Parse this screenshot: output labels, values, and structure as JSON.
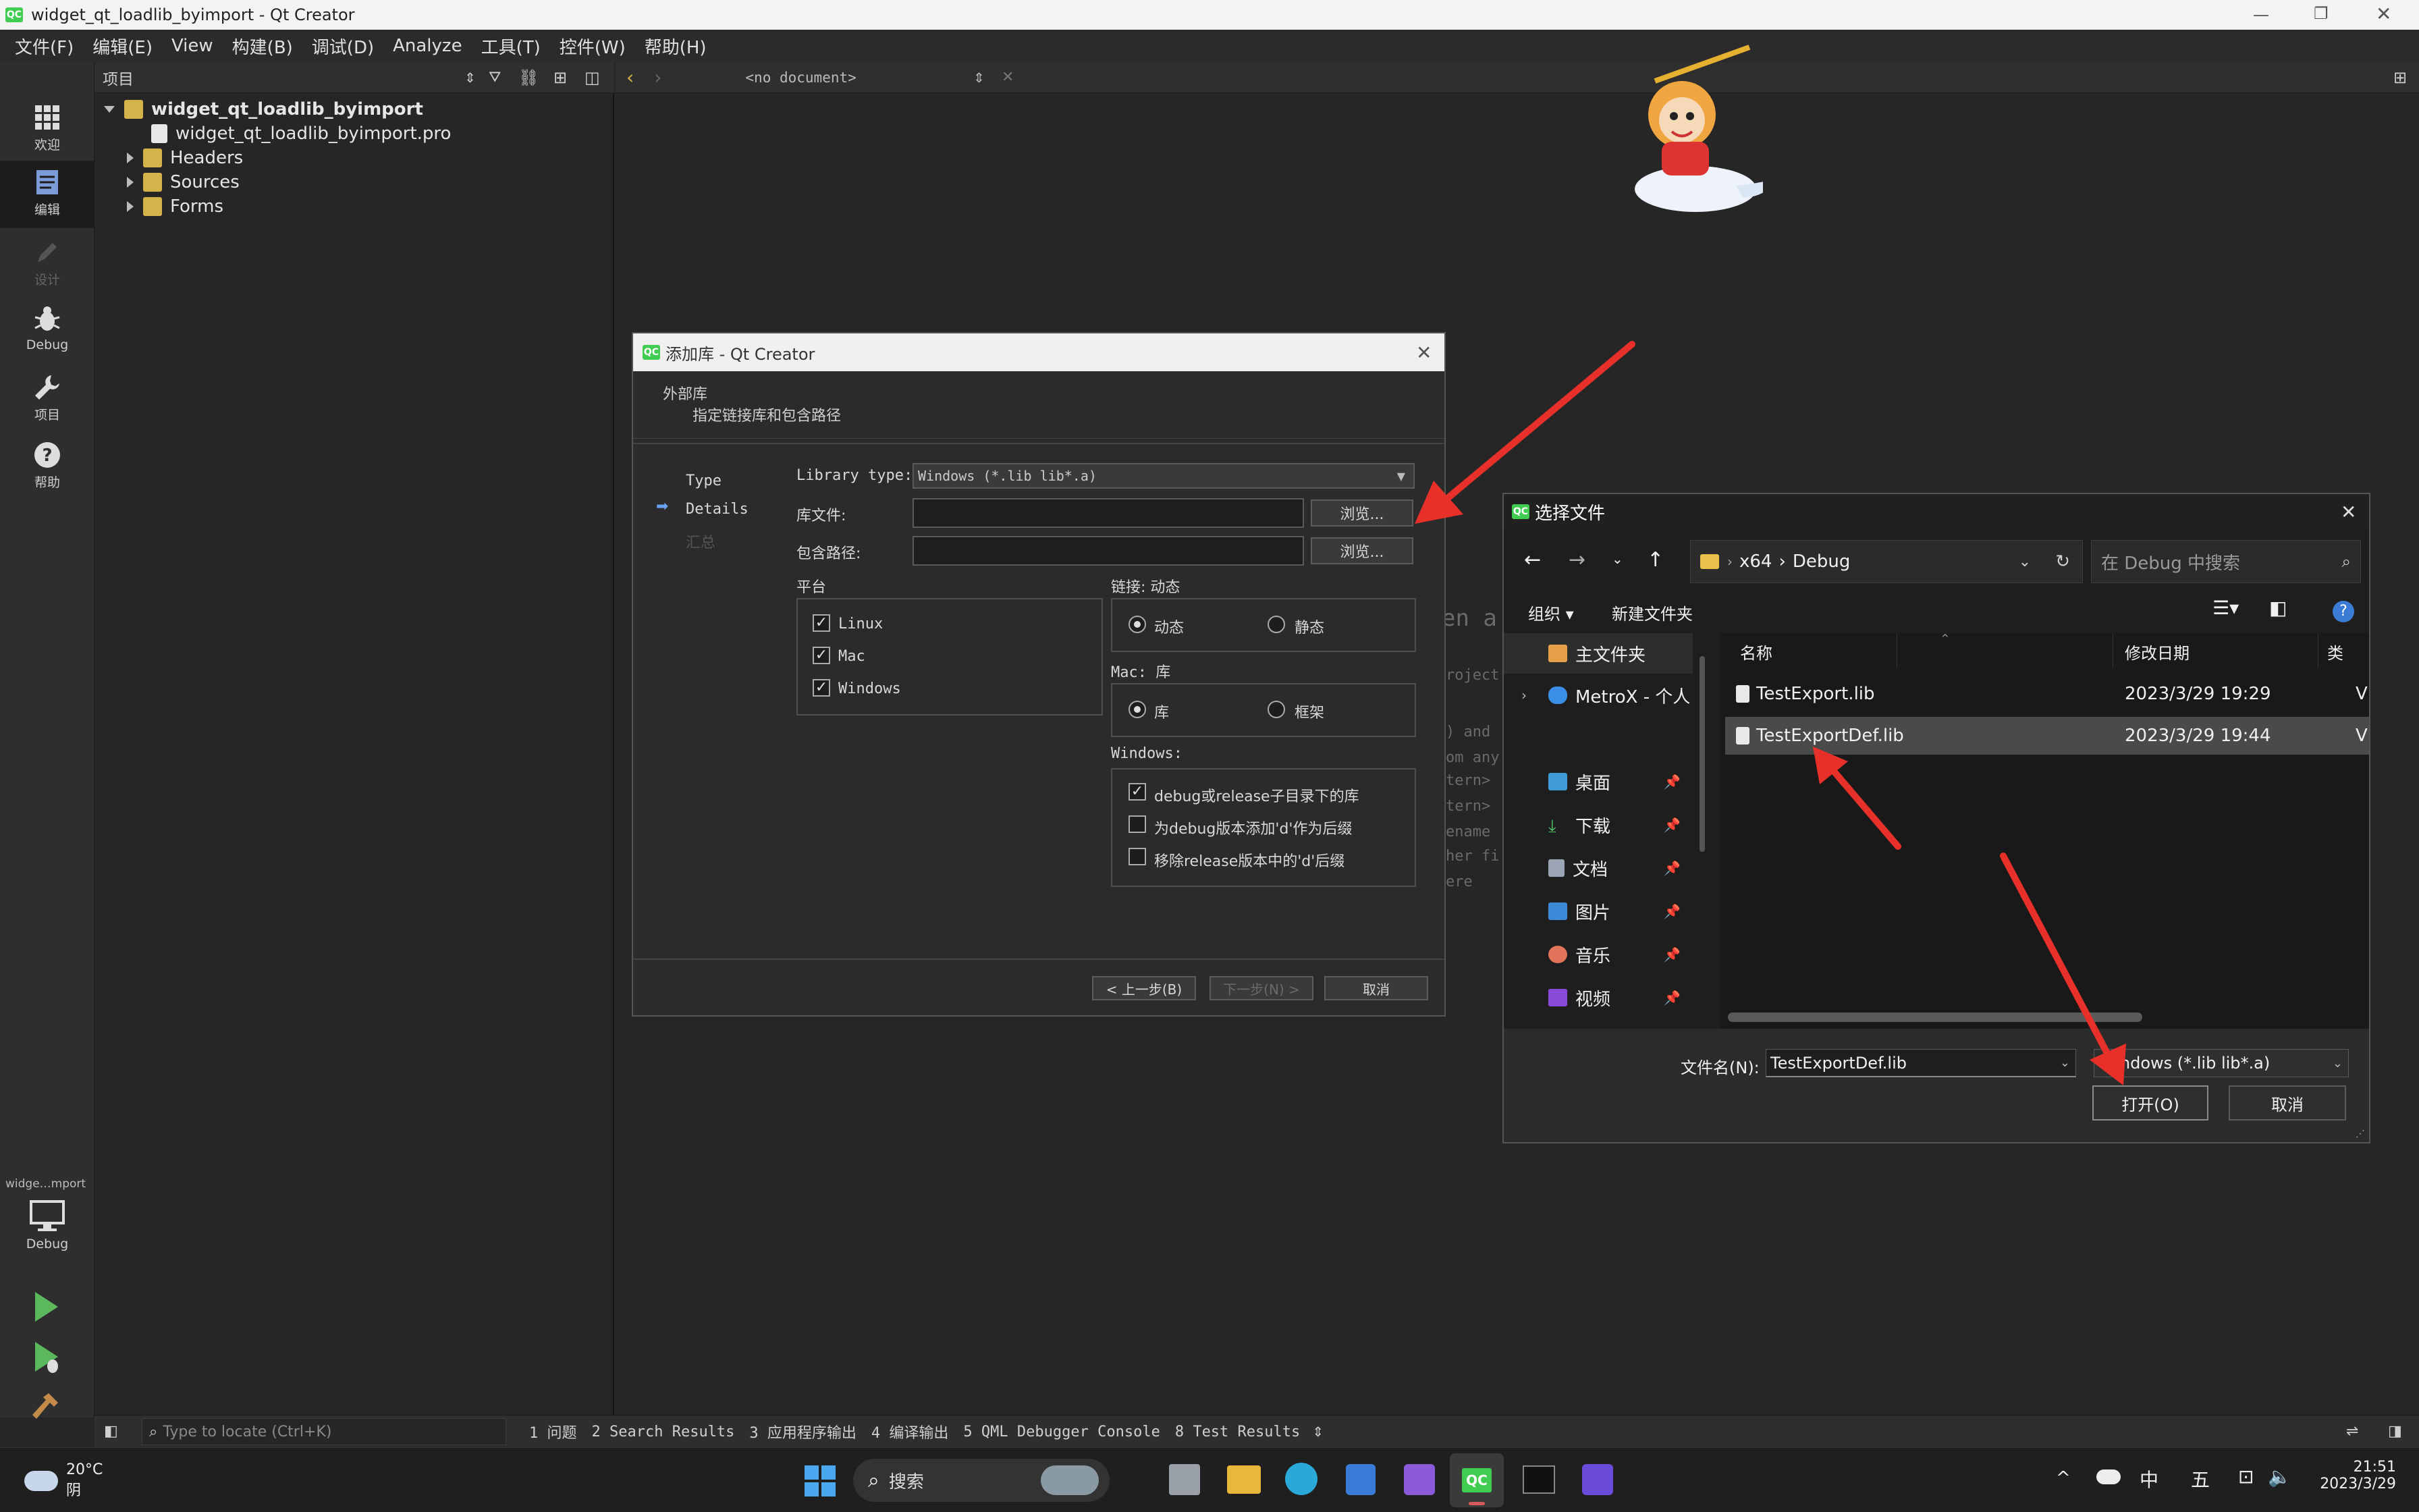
{
  "window": {
    "title": "widget_qt_loadlib_byimport - Qt Creator"
  },
  "menu": [
    "文件(F)",
    "编辑(E)",
    "View",
    "构建(B)",
    "调试(D)",
    "Analyze",
    "工具(T)",
    "控件(W)",
    "帮助(H)"
  ],
  "modes": [
    {
      "label": "欢迎",
      "icon": "grid-icon"
    },
    {
      "label": "编辑",
      "icon": "edit-icon"
    },
    {
      "label": "设计",
      "icon": "pencil-icon"
    },
    {
      "label": "Debug",
      "icon": "bug-icon"
    },
    {
      "label": "项目",
      "icon": "wrench-icon"
    },
    {
      "label": "帮助",
      "icon": "help-icon"
    }
  ],
  "target": {
    "name": "widge…mport",
    "config": "Debug"
  },
  "project_pane": {
    "title": "项目"
  },
  "tree": {
    "root": "widget_qt_loadlib_byimport",
    "pro": "widget_qt_loadlib_byimport.pro",
    "headers": "Headers",
    "sources": "Sources",
    "forms": "Forms"
  },
  "editor": {
    "doc_selector": "<no document>",
    "ghost_lines": [
      "en a",
      "roject",
      ") and",
      "om any",
      "tern>",
      "tern>",
      "ename",
      "her fi",
      "ere"
    ]
  },
  "output_bar": {
    "locate_placeholder": "Type to locate (Ctrl+K)",
    "tabs": [
      "1 问题",
      "2 Search Results",
      "3 应用程序输出",
      "4 编译输出",
      "5 QML Debugger Console",
      "8 Test Results"
    ]
  },
  "add_library": {
    "title": "添加库 - Qt Creator",
    "heading": "外部库",
    "subheading": "指定链接库和包含路径",
    "steps": [
      "Type",
      "Details",
      "汇总"
    ],
    "library_type_label": "Library type:",
    "library_type_value": "Windows (*.lib lib*.a)",
    "lib_file_label": "库文件:",
    "include_path_label": "包含路径:",
    "browse": "浏览...",
    "platform_group": "平台",
    "platforms": [
      "Linux",
      "Mac",
      "Windows"
    ],
    "link_group": "链接: 动态",
    "link_dynamic": "动态",
    "link_static": "静态",
    "mac_group": "Mac: 库",
    "mac_lib": "库",
    "mac_framework": "框架",
    "windows_group": "Windows:",
    "win_opt1": "debug或release子目录下的库",
    "win_opt2": "为debug版本添加'd'作为后缀",
    "win_opt3": "移除release版本中的'd'后缀",
    "back": "< 上一步(B)",
    "next": "下一步(N) >",
    "cancel": "取消"
  },
  "file_dialog": {
    "title": "选择文件",
    "breadcrumb": [
      "x64",
      "Debug"
    ],
    "search_placeholder": "在 Debug 中搜索",
    "organize": "组织",
    "new_folder": "新建文件夹",
    "nav": [
      {
        "label": "主文件夹",
        "icon": "home-icon"
      },
      {
        "label": "MetroX - 个人",
        "icon": "cloud-icon"
      },
      {
        "label": "桌面",
        "icon": "desktop-icon"
      },
      {
        "label": "下载",
        "icon": "download-icon"
      },
      {
        "label": "文档",
        "icon": "document-icon"
      },
      {
        "label": "图片",
        "icon": "picture-icon"
      },
      {
        "label": "音乐",
        "icon": "music-icon"
      },
      {
        "label": "视频",
        "icon": "video-icon"
      }
    ],
    "columns": [
      "名称",
      "修改日期",
      "类"
    ],
    "files": [
      {
        "name": "TestExport.lib",
        "date": "2023/3/29 19:29",
        "type": "V"
      },
      {
        "name": "TestExportDef.lib",
        "date": "2023/3/29 19:44",
        "type": "V"
      }
    ],
    "filename_label": "文件名(N):",
    "filename_value": "TestExportDef.lib",
    "filter_value": "Windows (*.lib lib*.a)",
    "open": "打开(O)",
    "cancel": "取消"
  },
  "taskbar": {
    "weather_temp": "20°C",
    "weather_desc": "阴",
    "search": "搜索",
    "ime": "中",
    "ime2": "五",
    "time": "21:51",
    "date": "2023/3/29"
  }
}
